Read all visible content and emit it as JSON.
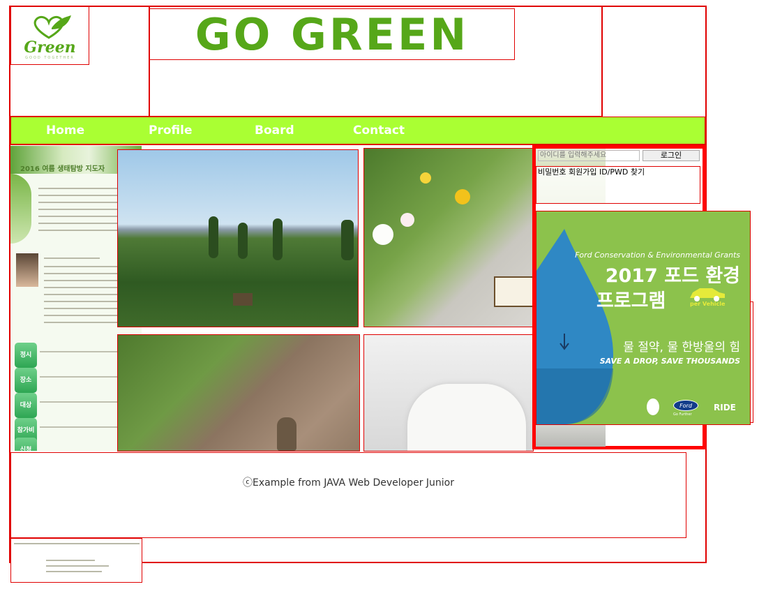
{
  "logo": {
    "word": "Green",
    "tagline": "GOOD TOGETHER",
    "icon": "heart-leaf-icon"
  },
  "banner": {
    "title": "GO GREEN",
    "icon": "leaf-icon"
  },
  "nav": {
    "items": [
      {
        "label": "Home"
      },
      {
        "label": "Profile"
      },
      {
        "label": "Board"
      },
      {
        "label": "Contact"
      }
    ]
  },
  "poster": {
    "title": "2016 여름 생태탐방 지도자",
    "menu": [
      "정시",
      "장소",
      "대상",
      "참가비",
      "신청"
    ]
  },
  "login": {
    "input_placeholder": "아이디를 입력해주세요",
    "login_button": "로그인",
    "remember": "비밀번호",
    "signup": "회원가입",
    "find": "ID/PWD 찾기"
  },
  "ad": {
    "top_line": "Ford Conservation & Environmental Grants",
    "title_line1": "2017 포드 환경",
    "title_line2": "프로그램",
    "badge": "per Vehicle",
    "subtitle": "물 절약, 물 한방울의 힘",
    "tagline": "SAVE A DROP, SAVE THOUSANDS",
    "sponsors": [
      "Ford",
      "Go Further",
      "RIDE"
    ]
  },
  "footer": {
    "text": "ⓒExample from JAVA Web Developer Junior"
  },
  "colors": {
    "accent_red": "#e00000",
    "nav_green": "#aaff33",
    "brand_green": "#56a719",
    "ad_green": "#8cc24c"
  }
}
